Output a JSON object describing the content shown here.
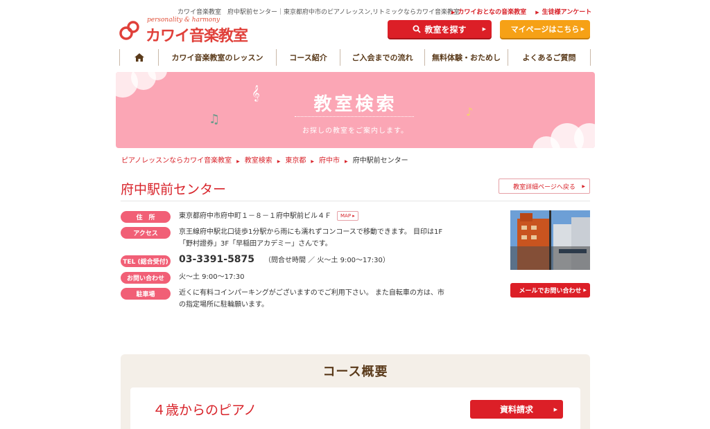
{
  "header": {
    "description": "カワイ音楽教室　府中駅前センター｜東京都府中市のピアノレッスン,リトミックならカワイ音楽教室",
    "top_links": [
      "カワイおとなの音楽教室",
      "生徒様アンケート"
    ],
    "logo_tagline": "personality & harmony",
    "logo_text": "カワイ音楽教室",
    "search_button": "教室を探す",
    "mypage_button": "マイページはこちら",
    "brand_color": "#dc1f27",
    "accent_color": "#f6a116"
  },
  "nav": {
    "home_icon": "home-icon",
    "items": [
      "カワイ音楽教室のレッスン",
      "コース紹介",
      "ご入会までの流れ",
      "無料体験・おためし",
      "よくあるご質問"
    ]
  },
  "banner": {
    "title": "教室検索",
    "subtitle": "お探しの教室をご案内します。"
  },
  "breadcrumb": {
    "items": [
      "ピアノレッスンならカワイ音楽教室",
      "教室検索",
      "東京都",
      "府中市"
    ],
    "current": "府中駅前センター"
  },
  "page": {
    "title": "府中駅前センター",
    "back_button": "教室詳細ページへ戻る"
  },
  "info": {
    "address_label": "住　所",
    "address": "東京都府中市府中町１－８－１府中駅前ビル４Ｆ",
    "map_button": "MAP",
    "access_label": "アクセス",
    "access_line1": "京王線府中駅北口徒歩1分駅から雨にも濡れずコンコースで移動できます。 目印は1F",
    "access_line2": "「野村證券」3F「早稲田アカデミー」さんです。",
    "tel_label": "TEL (総合受付)",
    "tel": "03-3391-5875",
    "tel_hours": "（問合せ時間 ／ 火～土 9:00～17:30）",
    "inquiry_label": "お問い合わせ",
    "inquiry_hours": "火～土 9:00～17:30",
    "parking_label": "駐車場",
    "parking_line1": "近くに有料コインパーキングがございますのでご利用下さい。 また自転車の方は、市",
    "parking_line2": "の指定場所に駐輪願います。",
    "mail_button": "メールでお問い合わせ"
  },
  "course": {
    "section_title": "コース概要",
    "name": "４歳からのピアノ",
    "request_button": "資料請求"
  }
}
